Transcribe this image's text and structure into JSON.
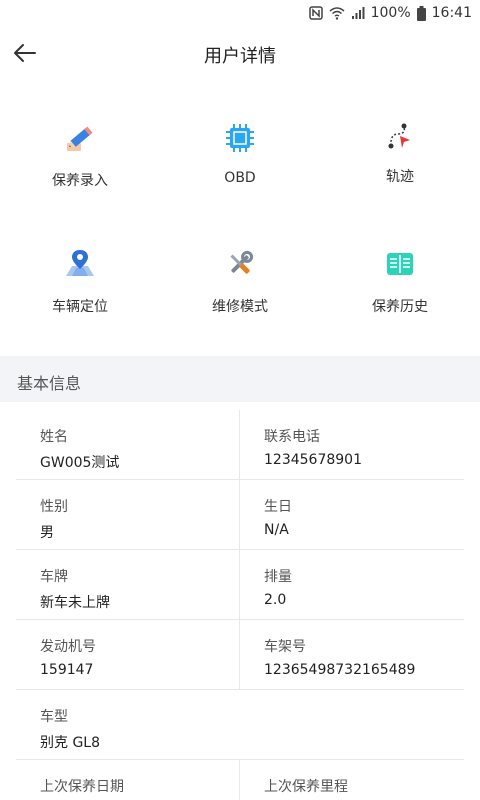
{
  "status_bar": {
    "battery": "100%",
    "time": "16:41"
  },
  "header": {
    "title": "用户详情"
  },
  "functions": [
    {
      "label": "保养录入",
      "icon": "pencil-icon"
    },
    {
      "label": "OBD",
      "icon": "chip-icon"
    },
    {
      "label": "轨迹",
      "icon": "route-icon"
    },
    {
      "label": "车辆定位",
      "icon": "map-pin-icon"
    },
    {
      "label": "维修模式",
      "icon": "tools-icon"
    },
    {
      "label": "保养历史",
      "icon": "book-icon"
    }
  ],
  "section": {
    "title": "基本信息"
  },
  "info": [
    {
      "left": {
        "label": "姓名",
        "value": "GW005测试"
      },
      "right": {
        "label": "联系电话",
        "value": "12345678901"
      }
    },
    {
      "left": {
        "label": "性别",
        "value": "男"
      },
      "right": {
        "label": "生日",
        "value": "N/A"
      }
    },
    {
      "left": {
        "label": "车牌",
        "value": "新车未上牌"
      },
      "right": {
        "label": "排量",
        "value": "2.0"
      }
    },
    {
      "left": {
        "label": "发动机号",
        "value": "159147"
      },
      "right": {
        "label": "车架号",
        "value": "12365498732165489"
      }
    },
    {
      "left": {
        "label": "车型",
        "value": "别克 GL8"
      }
    },
    {
      "left": {
        "label": "上次保养日期",
        "value": ""
      },
      "right": {
        "label": "上次保养里程",
        "value": ""
      }
    }
  ],
  "colors": {
    "section_bg": "#f2f4f7",
    "divider": "#e8e8e8",
    "chip_blue": "#2aa7f0",
    "pin_blue": "#2f6fd6",
    "book_teal": "#2ed3b7"
  }
}
